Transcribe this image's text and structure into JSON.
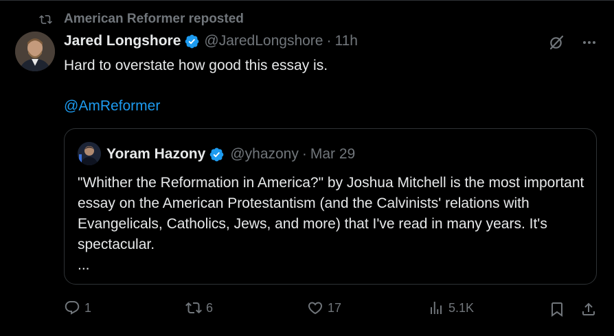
{
  "repost": {
    "label": "American Reformer reposted"
  },
  "tweet": {
    "author_name": "Jared Longshore",
    "handle": "@JaredLongshore",
    "separator": "·",
    "time": "11h",
    "text": "Hard to overstate how good this essay is.",
    "mention": "@AmReformer"
  },
  "quote": {
    "author_name": "Yoram Hazony",
    "handle": "@yhazony",
    "separator": "·",
    "date": "Mar 29",
    "body": "\"Whither the Reformation in America?\" by Joshua Mitchell is the most important essay on the American Protestantism (and the Calvinists' relations with Evangelicals, Catholics, Jews, and more) that I've read in many years. It's spectacular.",
    "ellipsis": "..."
  },
  "actions": {
    "replies": "1",
    "reposts": "6",
    "likes": "17",
    "views": "5.1K"
  },
  "icons": [
    "repost-icon",
    "verified-badge-icon",
    "grok-icon",
    "more-icon",
    "reply-icon",
    "like-icon",
    "views-icon",
    "bookmark-icon",
    "share-icon"
  ],
  "colors": {
    "background": "#000000",
    "text": "#e7e9ea",
    "muted": "#71767b",
    "accent": "#1d9bf0",
    "border": "#2f3336"
  }
}
